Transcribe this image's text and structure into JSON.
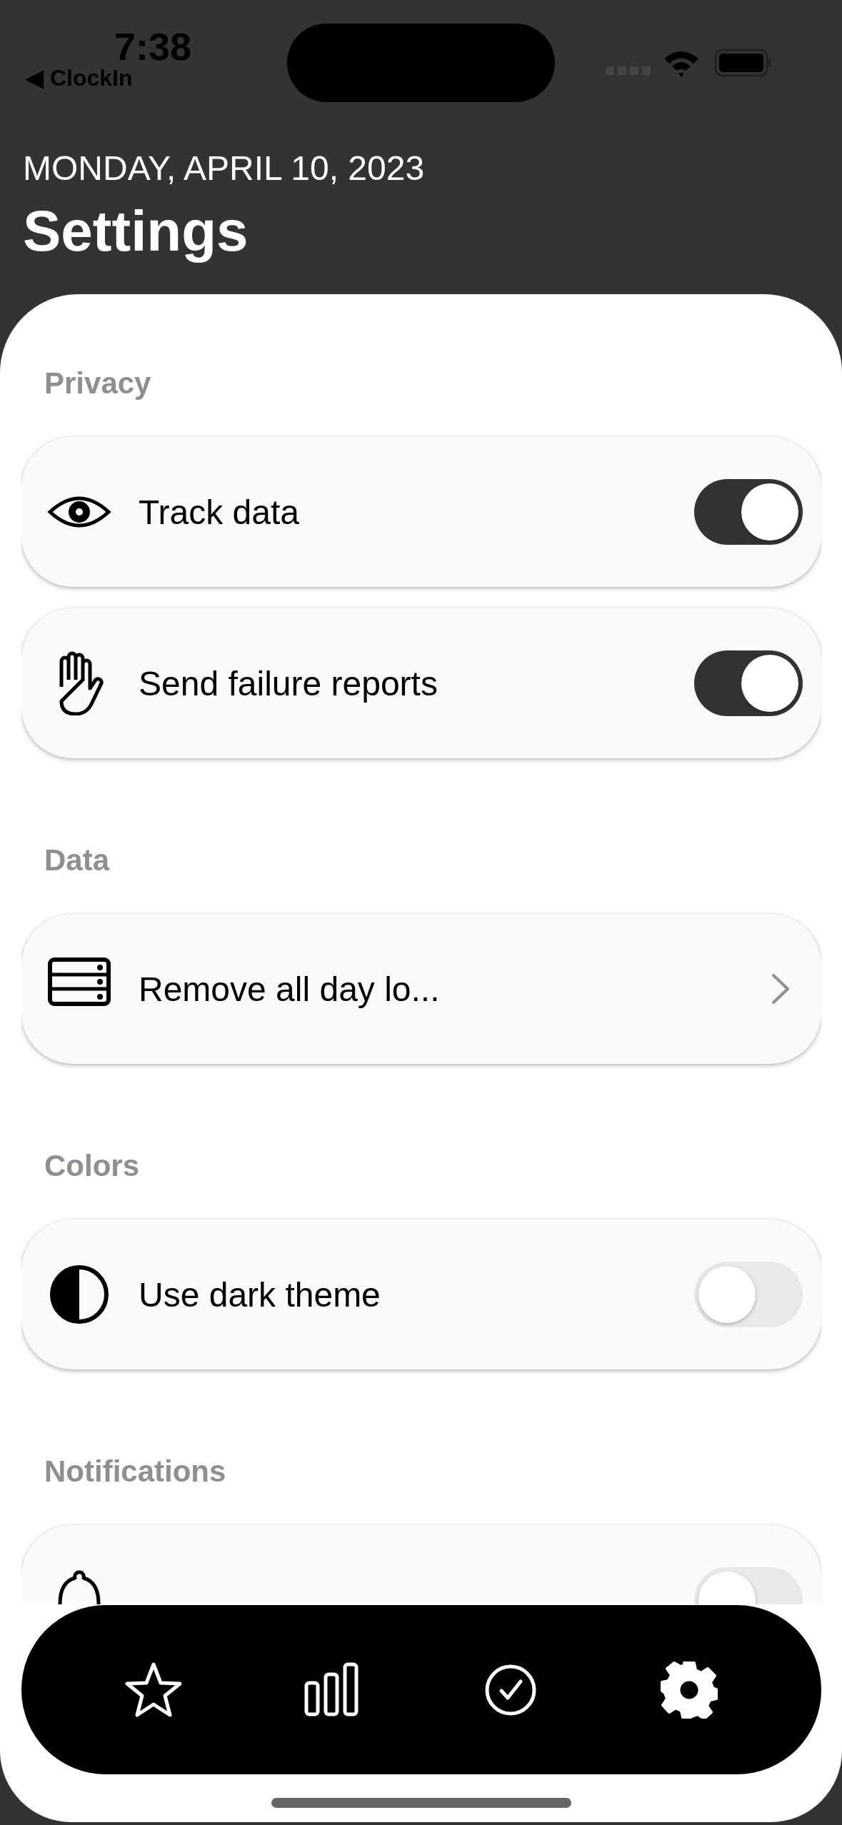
{
  "status_bar": {
    "time": "7:38",
    "back_label": "◀ ClockIn"
  },
  "header": {
    "date": "MONDAY, APRIL 10, 2023",
    "title": "Settings"
  },
  "sections": [
    {
      "title": "Privacy",
      "items": [
        {
          "kind": "toggle",
          "label": "Track data",
          "on": true
        },
        {
          "kind": "toggle",
          "label": "Send failure reports",
          "on": true
        }
      ]
    },
    {
      "title": "Data",
      "items": [
        {
          "kind": "link",
          "label": "Remove all day lo..."
        }
      ]
    },
    {
      "title": "Colors",
      "items": [
        {
          "kind": "toggle",
          "label": "Use dark theme",
          "on": false
        }
      ]
    },
    {
      "title": "Notifications",
      "items": [
        {
          "kind": "toggle",
          "on": false
        }
      ]
    }
  ],
  "tab_bar": [
    {
      "selected": false
    },
    {
      "selected": false
    },
    {
      "selected": false
    },
    {
      "selected": true
    }
  ]
}
